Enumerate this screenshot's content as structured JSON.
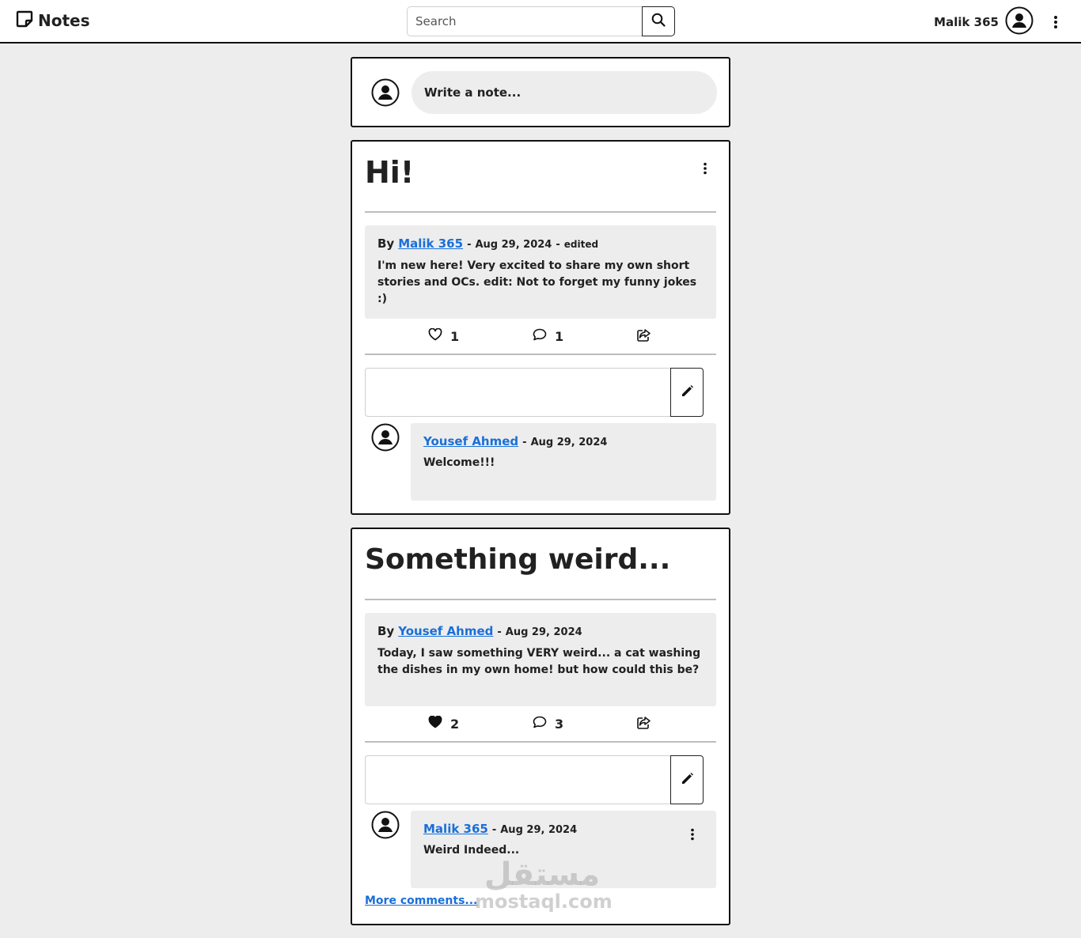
{
  "navbar": {
    "brand": "Notes",
    "search_placeholder": "Search",
    "user_name": "Malik 365"
  },
  "compose": {
    "placeholder": "Write a note..."
  },
  "posts": [
    {
      "title": "Hi!",
      "by_label": "By",
      "author": "Malik 365",
      "date": "Aug 29, 2024",
      "edited": "edited",
      "body": "I'm new here! Very excited to share my own short stories and OCs. edit: Not to forget my funny jokes :)",
      "likes": "1",
      "liked": false,
      "comments_count": "1",
      "comments": [
        {
          "author": "Yousef Ahmed",
          "date": "Aug 29, 2024",
          "text": "Welcome!!!"
        }
      ]
    },
    {
      "title": "Something weird...",
      "by_label": "By",
      "author": "Yousef Ahmed",
      "date": "Aug 29, 2024",
      "body": "Today, I saw something VERY weird... a cat washing the dishes in my own home! but how could this be?",
      "likes": "2",
      "liked": true,
      "comments_count": "3",
      "comments": [
        {
          "author": "Malik 365",
          "date": "Aug 29, 2024",
          "text": "Weird Indeed..."
        }
      ],
      "more_comments": "More comments..."
    }
  ],
  "watermark": {
    "arabic": "مستقل",
    "latin": "mostaql.com"
  },
  "colors": {
    "background": "#ededed",
    "link": "#1a6fd8",
    "border": "#111111"
  }
}
